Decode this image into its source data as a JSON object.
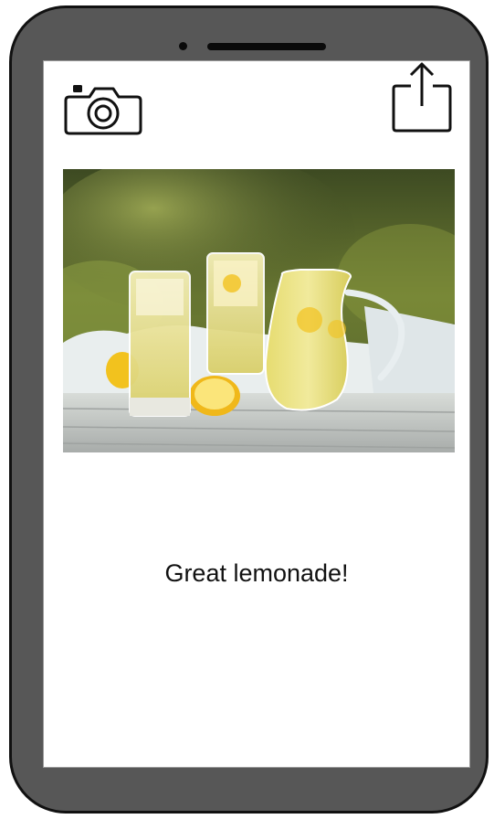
{
  "screen": {
    "caption": "Great lemonade!"
  },
  "icons": {
    "camera": "camera-icon",
    "share": "share-icon"
  },
  "photo": {
    "subject": "lemonade-photo"
  },
  "colors": {
    "shell": "#575757",
    "screen": "#ffffff",
    "caption_text": "#111111"
  }
}
